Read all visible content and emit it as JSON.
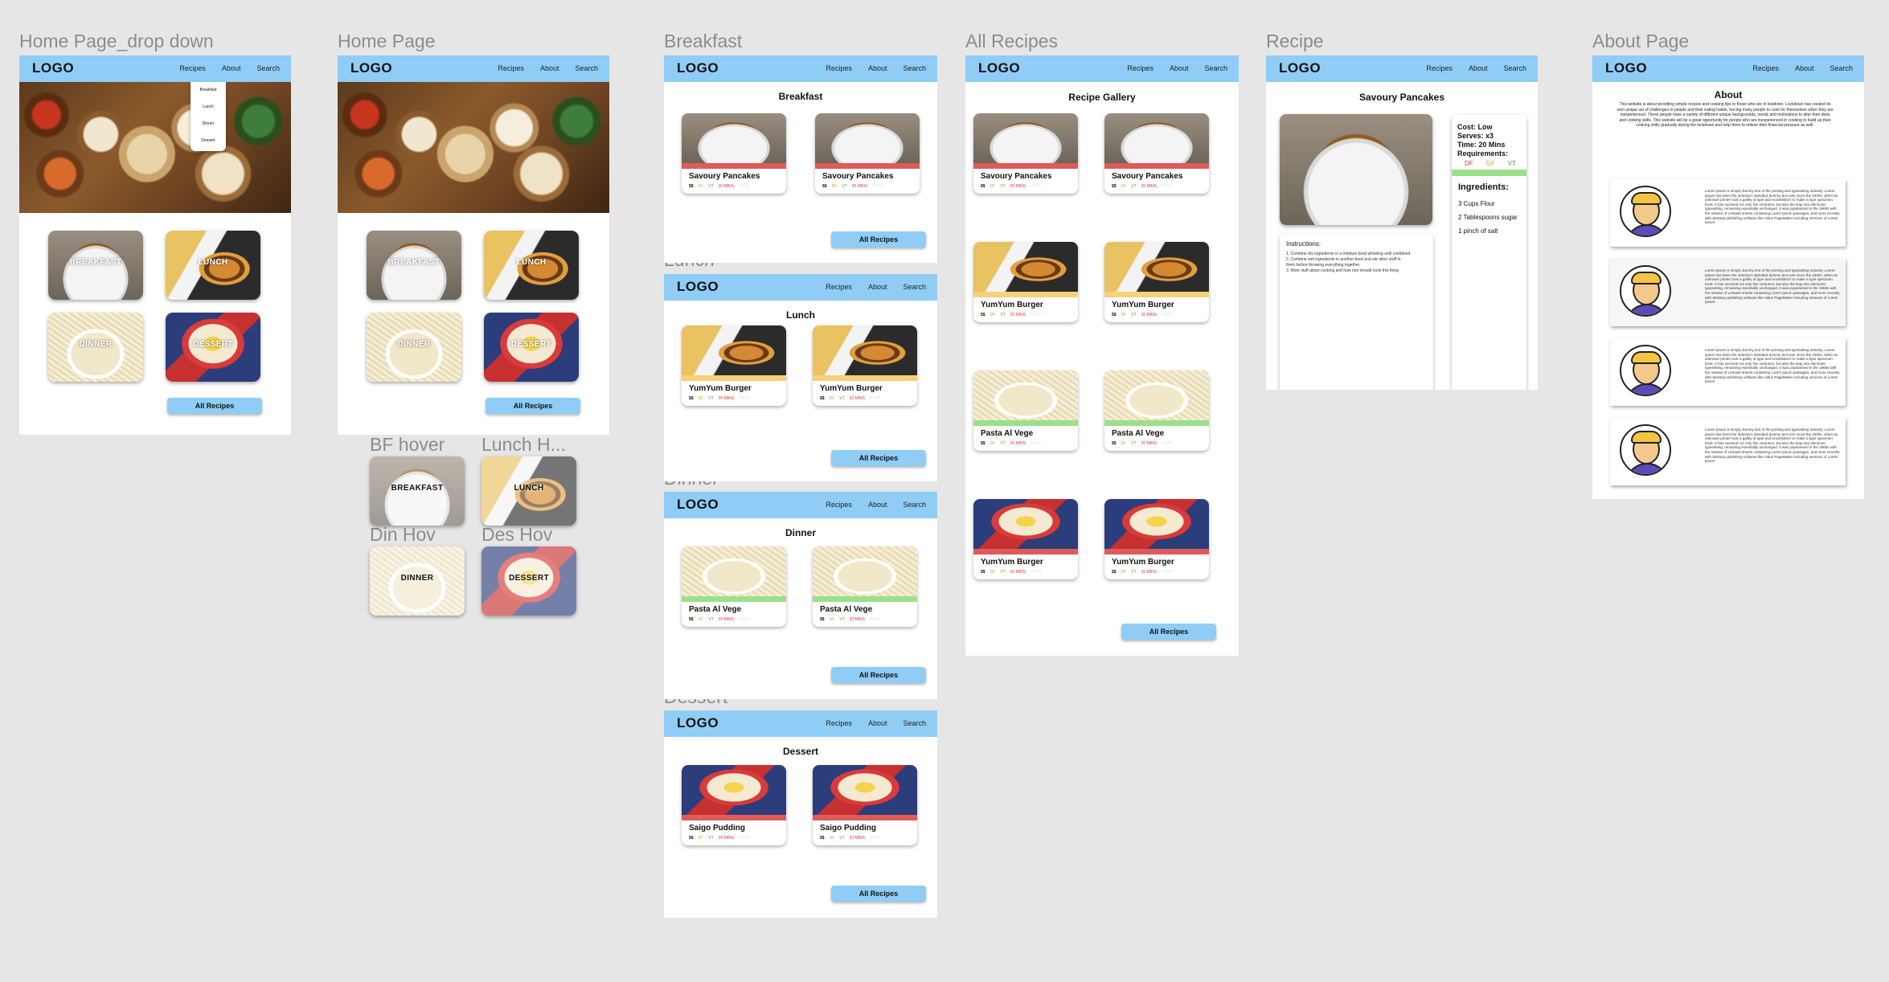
{
  "labels": {
    "home_dropdown": "Home Page_drop down",
    "home": "Home Page",
    "breakfast": "Breakfast",
    "lunch": "Lunch",
    "dinner": "Dinner",
    "dessert": "Dessert",
    "all_recipes": "All Recipes",
    "recipe": "Recipe",
    "about": "About Page",
    "bf_hover": "BF hover",
    "lunch_hover": "Lunch H...",
    "din_hov": "Din Hov",
    "des_hov": "Des Hov"
  },
  "nav": {
    "logo": "LOGO",
    "recipes": "Recipes",
    "about": "About",
    "search": "Search"
  },
  "dropdown": [
    "Breakfast",
    "Lunch",
    "Dinner",
    "Dessert"
  ],
  "tiles": {
    "breakfast": "BREAKFAST",
    "lunch": "LUNCH",
    "dinner": "DINNER",
    "dessert": "DESSERT"
  },
  "button": "All Recipes",
  "pages": {
    "breakfast_title": "Breakfast",
    "lunch_title": "Lunch",
    "dinner_title": "Dinner",
    "dessert_title": "Dessert",
    "gallery_title": "Recipe Gallery",
    "recipe_title": "Savoury Pancakes",
    "about_title": "About"
  },
  "dishes": {
    "pancakes": "Savoury Pancakes",
    "burger": "YumYum Burger",
    "pasta": "Pasta Al Vege",
    "pudding": "Saigo Pudding"
  },
  "tags": {
    "price": "$$",
    "df": "DF",
    "vt": "VT",
    "time": "20 MINS",
    "rating": "♡♡♡"
  },
  "recipe": {
    "cost": "Cost: Low",
    "serves": "Serves: x3",
    "time": "Time: 20 Mins",
    "requirements": "Requirements:",
    "req_df": "DF",
    "req_gf": "GF",
    "req_vt": "VT",
    "ingredients_title": "Ingredients:",
    "ing1": "3 Cups Flour",
    "ing2": "2 Tablespoons sugar",
    "ing3": "1 pinch of salt",
    "instructions_title": "Instructions:",
    "step1": "1. Combine dry ingredients in a medium bowl whisking until combined",
    "step2": "2. Combine wet ingredients in another bowl and stir other stuff in",
    "step2b": "them before throwing everything together.",
    "step3": "3. More stuff about cooking and how one should cook this thing"
  },
  "about": {
    "text": "This website is about providing simple recipes and cooking tips to those who are in lowdown. Lockdown has created its own unique set of challenges to people and their eating habits, forcing many people to cook for themselves when they are inexperienced. These people have a variety of different unique backgrounds, needs and motivations to alter their diets and cooking skills. This website will be a great opportunity for people who are inexperienced in cooking to build up their cooking skills gradually during the lockdown and help them to relieve their financial pressure as well.",
    "lorem": "Lorem Ipsum is simply dummy text of the printing and typesetting industry. Lorem Ipsum has been the industry's standard dummy text ever since the 1500s, when an unknown printer took a galley of type and scrambled it to make a type specimen book. It has survived not only five centuries, but also the leap into electronic typesetting, remaining essentially unchanged. It was popularised in the 1960s with the release of Letraset sheets containing Lorem Ipsum passages, and more recently with desktop publishing software like Aldus PageMaker including versions of Lorem Ipsum."
  },
  "colors": {
    "nav": "#8fcdf6",
    "pancake_stripe": "#e05a5a",
    "burger_stripe": "#f5d17a",
    "pasta_stripe": "#9be08a",
    "pudding_stripe": "#e05a5a"
  }
}
